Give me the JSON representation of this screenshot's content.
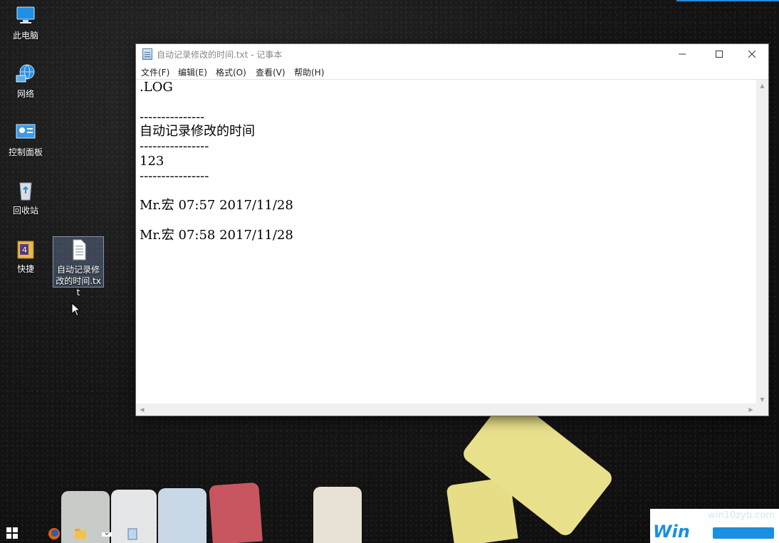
{
  "desktop": {
    "icons": [
      {
        "label": "此电脑"
      },
      {
        "label": "网络"
      },
      {
        "label": "控制面板"
      },
      {
        "label": "回收站"
      },
      {
        "label": "快捷"
      },
      {
        "label": "自动记录修改的时间.txt"
      }
    ]
  },
  "notepad": {
    "title": "自动记录修改的时间.txt - 记事本",
    "menu": [
      "文件(F)",
      "编辑(E)",
      "格式(O)",
      "查看(V)",
      "帮助(H)"
    ],
    "lines": [
      ".LOG",
      "",
      "---------------",
      "自动记录修改的时间",
      "----------------",
      "123",
      "----------------",
      "",
      "Mr.宏 07:57 2017/11/28",
      "",
      "Mr.宏 07:58 2017/11/28"
    ]
  },
  "watermark": {
    "site": "win10zyb.com",
    "brand": "Win"
  },
  "colors": {
    "accent": "#2b88d8",
    "window_bg": "#ffffff",
    "scrollbar_bg": "#f0f0f0"
  }
}
